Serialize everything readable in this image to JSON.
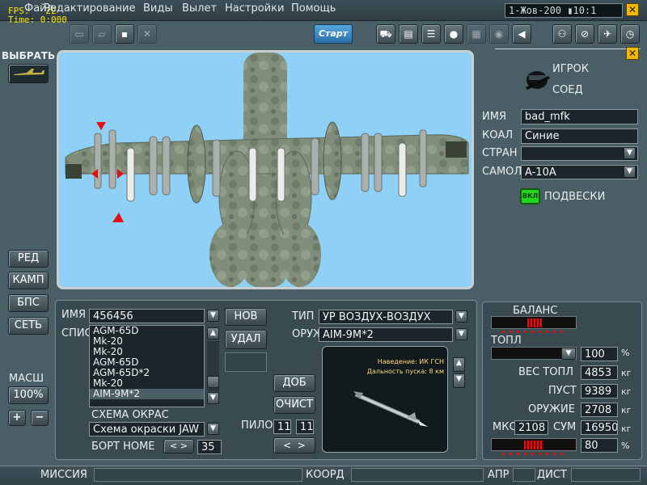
{
  "fps_counter": {
    "fps": "FPS:   22",
    "time": "Time: 0:000"
  },
  "menu": [
    "Файл",
    "Редактирование",
    "Виды",
    "Вылет",
    "Настройки",
    "Помощь"
  ],
  "clock": "1-Жов-200 ▮10:1",
  "toolbar": {
    "start_label": "Старт"
  },
  "select": {
    "label": "ВЫБРАТЬ"
  },
  "player": {
    "igrok_label": "ИГРОК",
    "soed_label": "СОЕД"
  },
  "form": {
    "name_label": "ИМЯ",
    "name_value": "bad_mfk",
    "coal_label": "КОАЛ",
    "coal_value": "Синие",
    "country_label": "СТРАН",
    "country_value": "",
    "aircraft_label": "САМОЛ",
    "aircraft_value": "A-10A",
    "toggle_label": "ВКЛ",
    "loadout_label": "ПОДВЕСКИ"
  },
  "side_buttons": [
    "РЕД",
    "КАМП",
    "БПС",
    "СЕТЬ"
  ],
  "scale": {
    "label": "МАСШ",
    "value": "100%",
    "plus": "+",
    "minus": "−"
  },
  "loadout": {
    "name_label": "ИМЯ",
    "name_value": "456456",
    "new_button": "НОВ",
    "delete_button": "УДАЛ",
    "list_label": "СПИС",
    "list_items": [
      "AGM-65D",
      "Mk-20",
      "Mk-20",
      "AGM-65D",
      "AGM-65D*2",
      "Mk-20",
      "AIM-9M*2"
    ],
    "paint_label": "СХЕМА ОКРАС",
    "paint_value": "Схема окраски JAW",
    "board_label": "БОРТ НОМЕ",
    "board_value": "35"
  },
  "weapon": {
    "type_label": "ТИП",
    "type_value": "УР ВОЗДУХ-ВОЗДУХ",
    "weapon_label": "ОРУЖ",
    "weapon_value": "AIM-9M*2",
    "info_line1": "Наведение: ИК ГСН",
    "info_line2": "Дальность пуска: 8 км",
    "add_button": "ДОБ",
    "clear_button": "ОЧИСТ",
    "pylon_label": "ПИЛО",
    "pylon_from": "11",
    "pylon_to": "11"
  },
  "fuel_panel": {
    "balance_label": "БАЛАНС",
    "fuel_label": "ТОПЛ",
    "fuel_value": "100",
    "fuel_unit": "%",
    "fuel_weight_label": "ВЕС ТОПЛ",
    "fuel_weight_value": "4853",
    "fuel_weight_unit": "кг",
    "empty_label": "ПУСТ",
    "empty_value": "9389",
    "empty_unit": "кг",
    "weapons_label": "ОРУЖИЕ",
    "weapons_value": "2708",
    "weapons_unit": "кг",
    "mtow_label": "МКС",
    "mtow_value": "2108",
    "sum_label": "СУМ",
    "sum_value": "16950",
    "sum_unit": "кг",
    "last_value": "80",
    "last_unit": "%"
  },
  "statusbar": {
    "mission_label": "МИССИЯ",
    "coord_label": "КООРД",
    "apr_label": "АПР",
    "dist_label": "ДИСТ"
  },
  "colors": {
    "sky": "#8fd0f6",
    "accent_start": "#3b8ccc",
    "close": "#f0b800",
    "toggle": "#23d51f",
    "gauge": "#e01010"
  }
}
